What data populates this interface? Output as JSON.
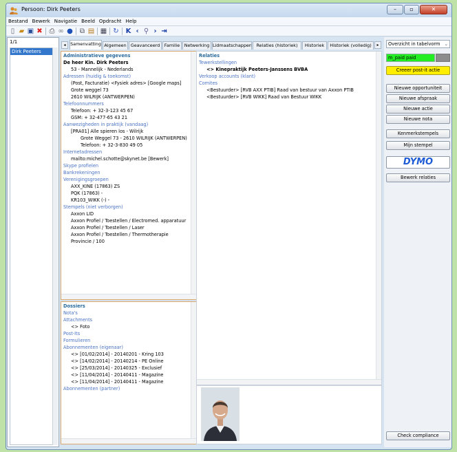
{
  "window": {
    "title": "Persoon: Dirk Peeters"
  },
  "menu": [
    "Bestand",
    "Bewerk",
    "Navigatie",
    "Beeld",
    "Opdracht",
    "Help"
  ],
  "toolbar_icons": [
    "new-icon",
    "open-icon",
    "save-icon",
    "delete-icon",
    "print-icon",
    "link-icon",
    "info-icon",
    "copy-icon",
    "paste-icon",
    "calendar-icon",
    "refresh-icon",
    "first-icon",
    "previous-icon",
    "search-icon",
    "next-icon",
    "last-icon"
  ],
  "left": {
    "count": "1/1",
    "selected": "Dirk Peeters"
  },
  "tabs": [
    "Samenvatting",
    "Algemeen",
    "Geavanceerd",
    "Familie",
    "Netwerking",
    "Lidmaatschappen",
    "Relaties (historiek)",
    "Historiek",
    "Historiek (volledig)"
  ],
  "admin": {
    "title": "Administratieve gegevens",
    "lines": [
      {
        "t": "De heer Kin. Dirk Peeters",
        "c": "bold",
        "i": 0
      },
      {
        "t": "53 - Mannelijk - Nederlands",
        "c": "",
        "i": 1
      },
      {
        "t": "Adressen (huidig & toekomst)",
        "c": "sec",
        "i": 0
      },
      {
        "t": "(Post, Facturatie) <Fysiek adres> [Google maps]",
        "c": "",
        "i": 1
      },
      {
        "t": "Grote weggel 73",
        "c": "",
        "i": 1
      },
      {
        "t": "2610 WILRIJK (ANTWERPEN)",
        "c": "",
        "i": 1
      },
      {
        "t": "Telefoonnummers",
        "c": "sec",
        "i": 0
      },
      {
        "t": "Telefoon: + 32-3-123 45 67",
        "c": "",
        "i": 1
      },
      {
        "t": "GSM: + 32-477-65 43 21",
        "c": "",
        "i": 1
      },
      {
        "t": "Aanwezigheden in praktijk (vandaag)",
        "c": "sec",
        "i": 0
      },
      {
        "t": "[PRA01] Alle spieren los - Wilrijk",
        "c": "",
        "i": 1
      },
      {
        "t": "Grote Weggel 73 - 2610 WILRIJK (ANTWERPEN)",
        "c": "",
        "i": 2
      },
      {
        "t": "Telefoon: + 32-3-830 49 05",
        "c": "",
        "i": 2
      },
      {
        "t": "Internetadressen",
        "c": "sec",
        "i": 0
      },
      {
        "t": "mailto:michel.schotte@skynet.be [Bewerk]",
        "c": "",
        "i": 1
      },
      {
        "t": "Skype profielen",
        "c": "sec",
        "i": 0
      },
      {
        "t": "Bankrekeningen",
        "c": "sec",
        "i": 0
      },
      {
        "t": "Verenigingsgroepen",
        "c": "sec",
        "i": 0
      },
      {
        "t": "AXX_KINE (17863) ZS",
        "c": "",
        "i": 1
      },
      {
        "t": "PQK (17863) -",
        "c": "",
        "i": 1
      },
      {
        "t": "KR103_WIKK (-) -",
        "c": "",
        "i": 1
      },
      {
        "t": "Stempels (niet verborgen)",
        "c": "sec",
        "i": 0
      },
      {
        "t": "Axxon LID",
        "c": "",
        "i": 1
      },
      {
        "t": "Axxon Profiel / Toestellen / Electromed. apparatuur",
        "c": "",
        "i": 1
      },
      {
        "t": "Axxon Profiel / Toestellen / Laser",
        "c": "",
        "i": 1
      },
      {
        "t": "Axxon Profiel / Toestellen / Thermotherapie",
        "c": "",
        "i": 1
      },
      {
        "t": "Provincie / 100",
        "c": "",
        "i": 1
      }
    ]
  },
  "relaties": {
    "title": "Relaties",
    "lines": [
      {
        "t": "Tewerkstellingen",
        "c": "sec",
        "i": 0
      },
      {
        "t": "<> Kinepraktijk Peeters-Janssens BVBA",
        "c": "bold",
        "i": 1
      },
      {
        "t": "Verkoop accounts (klant)",
        "c": "sec",
        "i": 0
      },
      {
        "t": "Comites",
        "c": "sec",
        "i": 0
      },
      {
        "t": "<Bestuurder> [RVB AXX PTIB] Raad van bestuur van Axxon PTIB",
        "c": "",
        "i": 1
      },
      {
        "t": "<Bestuurder> [RVB WIKK] Raad van Bestuur WIKK",
        "c": "",
        "i": 1
      }
    ]
  },
  "dossiers": {
    "title": "Dossiers",
    "lines": [
      {
        "t": "Nota's",
        "c": "sec",
        "i": 0
      },
      {
        "t": "Attachments",
        "c": "sec",
        "i": 0
      },
      {
        "t": "<> Foto",
        "c": "",
        "i": 1
      },
      {
        "t": "Post-Its",
        "c": "sec",
        "i": 0
      },
      {
        "t": "Formulieren",
        "c": "sec",
        "i": 0
      },
      {
        "t": "Abonnementen (eigenaar)",
        "c": "sec",
        "i": 0
      },
      {
        "t": "<> [01/02/2014] - 20140201 - Kring 103",
        "c": "",
        "i": 1
      },
      {
        "t": "<> [14/02/2014] - 20140214 - PE Online",
        "c": "",
        "i": 1
      },
      {
        "t": "<> [25/03/2014] - 20140325 - Exclusief",
        "c": "",
        "i": 1
      },
      {
        "t": "<> [11/04/2014] - 20140411 - Magazine",
        "c": "",
        "i": 1
      },
      {
        "t": "<> [11/04/2014] - 20140411 - Magazine",
        "c": "",
        "i": 1
      },
      {
        "t": "Abonnementen (partner)",
        "c": "sec",
        "i": 0
      }
    ]
  },
  "right": {
    "view_select": "Overzicht in tabelvorm",
    "status_field": "m_paid  paid",
    "postit": "Creeer post-it actie",
    "buttons": [
      "Nieuwe opportuniteit",
      "Nieuwe afspraak",
      "Nieuwe actie",
      "Nieuwe nota"
    ],
    "stamps": [
      "Kenmerkstempels",
      "Mijn stempel"
    ],
    "dymo": "DYMO",
    "edit_relations": "Bewerk relaties",
    "compliance": "Check compliance"
  },
  "colors": {
    "accent_green": "#22ee22",
    "postit_yellow": "#ffee00",
    "panel_border": "#dba86e",
    "section_blue": "#4a73c4"
  }
}
